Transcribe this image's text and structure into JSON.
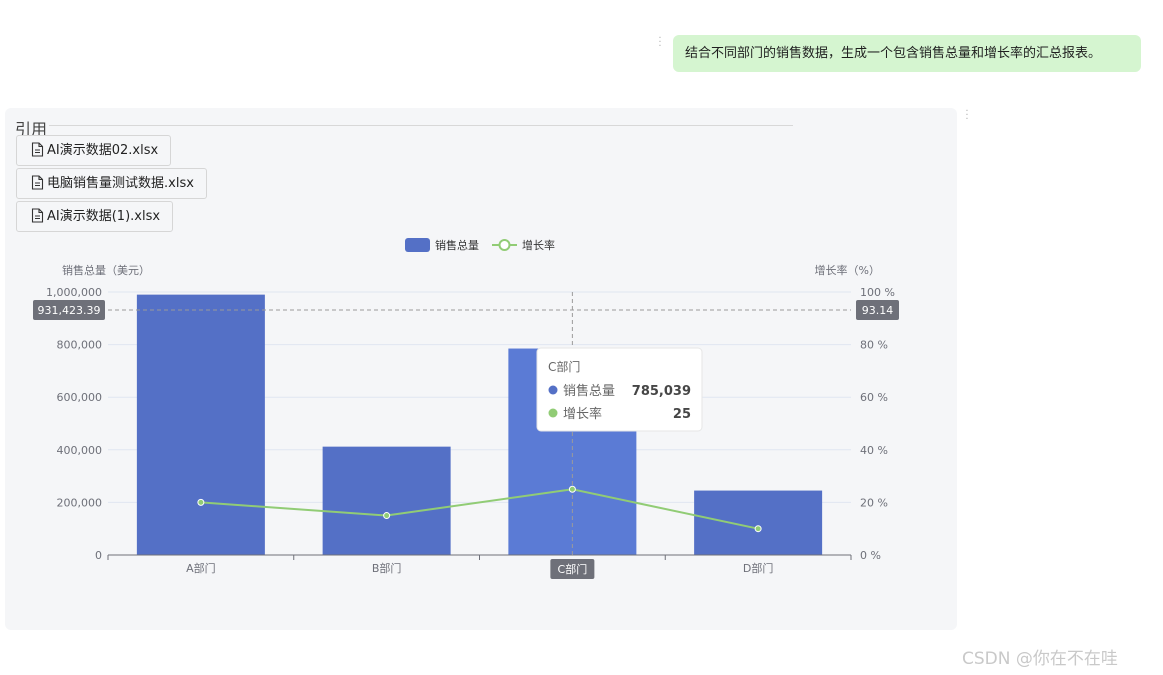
{
  "conversation": {
    "user_message": "结合不同部门的销售数据，生成一个包含销售总量和增长率的汇总报表。"
  },
  "references": {
    "title": "引用",
    "files": [
      {
        "name": "AI演示数据02.xlsx",
        "icon": "file-icon"
      },
      {
        "name": "电脑销售量测试数据.xlsx",
        "icon": "file-icon"
      },
      {
        "name": "AI演示数据(1).xlsx",
        "icon": "file-icon"
      }
    ]
  },
  "chart_data": {
    "type": "bar",
    "categories": [
      "A部门",
      "B部门",
      "C部门",
      "D部门"
    ],
    "series": [
      {
        "name": "销售总量",
        "type": "bar",
        "axis": "left",
        "color": "#5470c6",
        "values": [
          990000,
          412000,
          785039,
          245000
        ]
      },
      {
        "name": "增长率",
        "type": "line",
        "axis": "right",
        "color": "#91cc75",
        "values": [
          20,
          15,
          25,
          10
        ]
      }
    ],
    "ylabel": "销售总量（美元）",
    "ylabel_right": "增长率（%）",
    "ylim": [
      0,
      1000000
    ],
    "ylim_right": [
      0,
      100
    ],
    "yticks": [
      "0",
      "200,000",
      "400,000",
      "600,000",
      "800,000",
      "1,000,000"
    ],
    "yticks_right": [
      "0 %",
      "20 %",
      "40 %",
      "60 %",
      "80 %",
      "100 %"
    ],
    "legend_position": "top-center",
    "grid": true,
    "pointer": {
      "category_index": 2,
      "category_label": "C部门",
      "left_value": 931423.39,
      "left_label": "931,423.39",
      "right_label": "93.14"
    },
    "tooltip": {
      "title": "C部门",
      "rows": [
        {
          "name": "销售总量",
          "value": "785,039",
          "color": "#5470c6"
        },
        {
          "name": "增长率",
          "value": "25",
          "color": "#91cc75"
        }
      ]
    }
  },
  "watermark": "CSDN @你在不在哇"
}
